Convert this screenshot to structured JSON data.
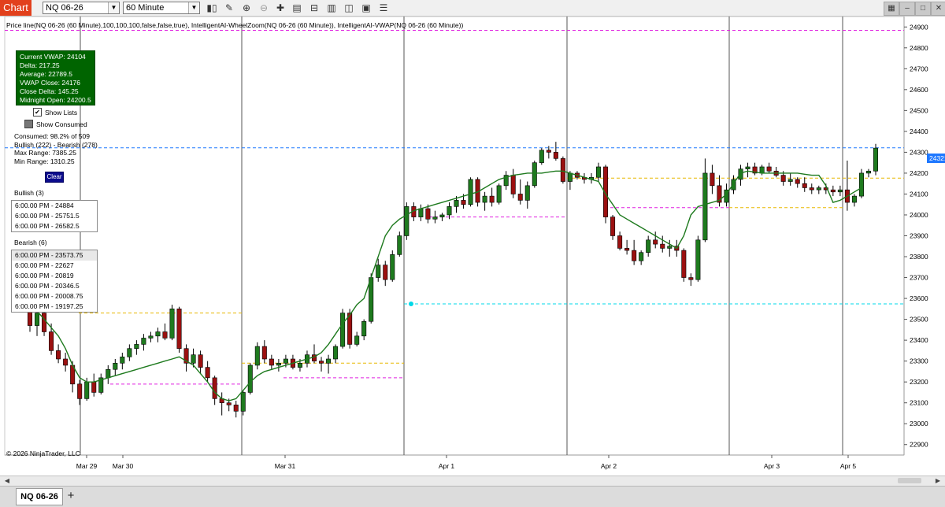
{
  "toolbar": {
    "chart_tab": "Chart",
    "instrument": "NQ 06-26",
    "interval": "60 Minute",
    "tools": [
      "bars-icon",
      "pencil-icon",
      "zoom-in-icon",
      "zoom-out-icon",
      "crosshair-icon",
      "properties-icon",
      "strategies-icon",
      "indicators-icon",
      "data-box-icon",
      "chart-trader-icon",
      "templates-icon",
      "share-icon"
    ],
    "window_buttons": [
      "restore-icon",
      "minimize-icon",
      "maximize-icon",
      "close-icon"
    ]
  },
  "indicator_line": "Price line(NQ 06-26 (60 Minute),100,100,100,false,false,true), IntelligentAI-WheelZoom(NQ 06-26 (60 Minute)), IntelligentAI-VWAP(NQ 06-26 (60 Minute))",
  "vwap_box": {
    "current_vwap": "Current VWAP: 24104",
    "delta": "Delta: 217.25",
    "average": "Average: 22789.5",
    "vwap_close": "VWAP Close: 24176",
    "close_delta": "Close Delta: 145.25",
    "midnight_open": "Midnight Open: 24200.5"
  },
  "options": {
    "show_lists": "Show Lists",
    "show_lists_checked": true,
    "show_consumed": "Show Consumed",
    "show_consumed_checked": false
  },
  "stats": {
    "consumed": "Consumed: 98.2% of 509",
    "bull_bear": "Bullish (222) - Bearish (278)",
    "max_range": "Max Range: 7385.25",
    "min_range": "Min Range: 1310.25"
  },
  "clear_button": "Clear",
  "bullish": {
    "title": "Bullish (3)",
    "rows": [
      "6:00.00 PM - 24884",
      "6:00.00 PM - 25751.5",
      "6:00.00 PM - 26582.5"
    ]
  },
  "bearish": {
    "title": "Bearish (6)",
    "rows": [
      "6:00.00 PM - 23573.75",
      "6:00.00 PM - 22627",
      "6:00.00 PM - 20819",
      "6:00.00 PM - 20346.5",
      "6:00.00 PM - 20008.75",
      "6:00.00 PM - 19197.25"
    ]
  },
  "copyright": "© 2026 NinjaTrader, LLC",
  "last_price": "24321.25",
  "bottom": {
    "tab": "NQ 06-26",
    "add": "+"
  },
  "colors": {
    "bull": "#1e7a1e",
    "bear": "#9b1010",
    "vwap": "#1e7a1e",
    "vwap_bear": "#9b1010",
    "magenta": "#e020e0",
    "gold": "#e8b800",
    "cyan": "#00d8e8",
    "price_line": "#1e78ff"
  },
  "chart_data": {
    "type": "candlestick",
    "y_ticks": [
      22900,
      23000,
      23100,
      23200,
      23300,
      23400,
      23500,
      23600,
      23700,
      23800,
      23900,
      24000,
      24100,
      24200,
      24300,
      24400,
      24500,
      24600,
      24700,
      24800,
      24900
    ],
    "ylim": [
      22850,
      24950
    ],
    "x_labels": [
      "Mar 29",
      "Mar 30",
      "Mar 31",
      "Apr 1",
      "Apr 2",
      "Apr 3",
      "Apr 5"
    ],
    "session_breaks": [
      "Mar 29",
      "Mar 31",
      "Apr 1",
      "Apr 2",
      "Apr 3",
      "Apr 5"
    ],
    "ohlc": [
      [
        23560,
        23575,
        23440,
        23470
      ],
      [
        23470,
        23560,
        23420,
        23530
      ],
      [
        23530,
        23560,
        23420,
        23440
      ],
      [
        23440,
        23480,
        23330,
        23350
      ],
      [
        23350,
        23380,
        23290,
        23310
      ],
      [
        23310,
        23340,
        23250,
        23280
      ],
      [
        23280,
        23300,
        23150,
        23190
      ],
      [
        23190,
        23210,
        23090,
        23120
      ],
      [
        23120,
        23220,
        23110,
        23200
      ],
      [
        23200,
        23240,
        23130,
        23150
      ],
      [
        23150,
        23240,
        23140,
        23220
      ],
      [
        23220,
        23280,
        23190,
        23260
      ],
      [
        23260,
        23310,
        23230,
        23290
      ],
      [
        23290,
        23340,
        23260,
        23320
      ],
      [
        23320,
        23380,
        23300,
        23360
      ],
      [
        23360,
        23400,
        23330,
        23380
      ],
      [
        23380,
        23430,
        23350,
        23410
      ],
      [
        23410,
        23440,
        23390,
        23420
      ],
      [
        23420,
        23460,
        23390,
        23440
      ],
      [
        23440,
        23480,
        23400,
        23410
      ],
      [
        23410,
        23570,
        23400,
        23550
      ],
      [
        23550,
        23560,
        23340,
        23360
      ],
      [
        23360,
        23380,
        23250,
        23290
      ],
      [
        23290,
        23360,
        23270,
        23330
      ],
      [
        23330,
        23350,
        23240,
        23270
      ],
      [
        23270,
        23300,
        23200,
        23220
      ],
      [
        23220,
        23230,
        23090,
        23120
      ],
      [
        23120,
        23150,
        23040,
        23100
      ],
      [
        23100,
        23120,
        23060,
        23090
      ],
      [
        23090,
        23110,
        23030,
        23060
      ],
      [
        23060,
        23160,
        23040,
        23150
      ],
      [
        23150,
        23290,
        23140,
        23280
      ],
      [
        23280,
        23390,
        23260,
        23370
      ],
      [
        23370,
        23400,
        23290,
        23310
      ],
      [
        23310,
        23330,
        23260,
        23280
      ],
      [
        23280,
        23310,
        23250,
        23290
      ],
      [
        23290,
        23330,
        23270,
        23310
      ],
      [
        23310,
        23330,
        23260,
        23270
      ],
      [
        23270,
        23310,
        23250,
        23290
      ],
      [
        23290,
        23350,
        23270,
        23330
      ],
      [
        23330,
        23380,
        23290,
        23300
      ],
      [
        23300,
        23320,
        23250,
        23290
      ],
      [
        23290,
        23330,
        23240,
        23310
      ],
      [
        23310,
        23380,
        23290,
        23370
      ],
      [
        23370,
        23550,
        23360,
        23530
      ],
      [
        23530,
        23550,
        23360,
        23380
      ],
      [
        23380,
        23440,
        23370,
        23420
      ],
      [
        23420,
        23500,
        23400,
        23490
      ],
      [
        23490,
        23720,
        23480,
        23700
      ],
      [
        23700,
        23790,
        23680,
        23760
      ],
      [
        23760,
        23780,
        23660,
        23690
      ],
      [
        23690,
        23830,
        23680,
        23810
      ],
      [
        23810,
        23920,
        23800,
        23900
      ],
      [
        23900,
        24060,
        23880,
        24040
      ],
      [
        24040,
        24060,
        23970,
        23990
      ],
      [
        23990,
        24050,
        23970,
        24030
      ],
      [
        24030,
        24050,
        23960,
        23980
      ],
      [
        23980,
        24020,
        23960,
        23990
      ],
      [
        23990,
        24010,
        23970,
        24000
      ],
      [
        24000,
        24060,
        23980,
        24040
      ],
      [
        24040,
        24090,
        24010,
        24070
      ],
      [
        24070,
        24100,
        24030,
        24050
      ],
      [
        24050,
        24180,
        24040,
        24170
      ],
      [
        24170,
        24180,
        24040,
        24060
      ],
      [
        24060,
        24110,
        24020,
        24090
      ],
      [
        24090,
        24130,
        24040,
        24060
      ],
      [
        24060,
        24150,
        24050,
        24140
      ],
      [
        24140,
        24210,
        24120,
        24190
      ],
      [
        24190,
        24220,
        24080,
        24100
      ],
      [
        24100,
        24170,
        24050,
        24070
      ],
      [
        24070,
        24160,
        24030,
        24140
      ],
      [
        24140,
        24260,
        24130,
        24250
      ],
      [
        24250,
        24320,
        24240,
        24310
      ],
      [
        24310,
        24330,
        24270,
        24300
      ],
      [
        24300,
        24350,
        24260,
        24270
      ],
      [
        24270,
        24280,
        24150,
        24160
      ],
      [
        24160,
        24210,
        24120,
        24200
      ],
      [
        24200,
        24210,
        24170,
        24180
      ],
      [
        24180,
        24200,
        24150,
        24170
      ],
      [
        24170,
        24200,
        24150,
        24180
      ],
      [
        24180,
        24250,
        24160,
        24230
      ],
      [
        24230,
        24240,
        23960,
        23990
      ],
      [
        23990,
        24000,
        23880,
        23900
      ],
      [
        23900,
        23920,
        23830,
        23840
      ],
      [
        23840,
        23880,
        23810,
        23830
      ],
      [
        23830,
        23880,
        23760,
        23780
      ],
      [
        23780,
        23830,
        23760,
        23820
      ],
      [
        23820,
        23900,
        23800,
        23880
      ],
      [
        23880,
        23920,
        23840,
        23860
      ],
      [
        23860,
        23900,
        23820,
        23840
      ],
      [
        23840,
        23880,
        23800,
        23850
      ],
      [
        23850,
        23880,
        23800,
        23830
      ],
      [
        23830,
        23840,
        23680,
        23700
      ],
      [
        23700,
        23720,
        23660,
        23690
      ],
      [
        23690,
        23900,
        23680,
        23880
      ],
      [
        23880,
        24270,
        23870,
        24200
      ],
      [
        24200,
        24240,
        24100,
        24140
      ],
      [
        24140,
        24190,
        24040,
        24060
      ],
      [
        24060,
        24150,
        24040,
        24120
      ],
      [
        24120,
        24190,
        24100,
        24170
      ],
      [
        24170,
        24240,
        24140,
        24220
      ],
      [
        24220,
        24250,
        24180,
        24230
      ],
      [
        24230,
        24250,
        24190,
        24200
      ],
      [
        24200,
        24240,
        24190,
        24230
      ],
      [
        24230,
        24250,
        24200,
        24210
      ],
      [
        24210,
        24230,
        24180,
        24190
      ],
      [
        24190,
        24210,
        24140,
        24160
      ],
      [
        24160,
        24200,
        24140,
        24170
      ],
      [
        24170,
        24180,
        24130,
        24150
      ],
      [
        24150,
        24180,
        24110,
        24130
      ],
      [
        24130,
        24150,
        24100,
        24120
      ],
      [
        24120,
        24140,
        24100,
        24130
      ],
      [
        24130,
        24150,
        24100,
        24120
      ],
      [
        24120,
        24140,
        24090,
        24110
      ],
      [
        24110,
        24140,
        24090,
        24120
      ],
      [
        24120,
        24260,
        24020,
        24060
      ],
      [
        24060,
        24100,
        24040,
        24090
      ],
      [
        24090,
        24220,
        24080,
        24200
      ],
      [
        24200,
        24220,
        24180,
        24210
      ],
      [
        24210,
        24340,
        24190,
        24320
      ]
    ],
    "vwap": [
      23580,
      23540,
      23500,
      23460,
      23420,
      23360,
      23280,
      23220,
      23200,
      23200,
      23210,
      23220,
      23230,
      23240,
      23250,
      23260,
      23270,
      23280,
      23290,
      23300,
      23310,
      23320,
      23300,
      23280,
      23240,
      23200,
      23150,
      23120,
      23110,
      23120,
      23160,
      23200,
      23230,
      23250,
      23260,
      23270,
      23280,
      23290,
      23300,
      23310,
      23320,
      23340,
      23380,
      23430,
      23480,
      23520,
      23570,
      23600,
      23700,
      23800,
      23900,
      23950,
      23980,
      24000,
      24020,
      24030,
      24040,
      24050,
      24060,
      24070,
      24080,
      24090,
      24100,
      24110,
      24130,
      24150,
      24170,
      24180,
      24190,
      24195,
      24200,
      24200,
      24200,
      24205,
      24210,
      24210,
      24200,
      24190,
      24180,
      24170,
      24160,
      24100,
      24050,
      24000,
      23980,
      23960,
      23940,
      23920,
      23900,
      23880,
      23860,
      23840,
      23900,
      24000,
      24040,
      24050,
      24060,
      24070,
      24100,
      24150,
      24200,
      24210,
      24205,
      24200,
      24200,
      24200,
      24200,
      24200,
      24200,
      24195,
      24190,
      24190,
      24140,
      24060,
      24070,
      24090,
      24110,
      24130
    ],
    "levels": [
      {
        "kind": "magenta",
        "price": 24884
      },
      {
        "kind": "price_line",
        "price": 24321.25
      },
      {
        "kind": "gold",
        "price": 23530
      },
      {
        "kind": "magenta",
        "price": 23190
      },
      {
        "kind": "gold",
        "price": 23290
      },
      {
        "kind": "magenta",
        "price": 23220
      },
      {
        "kind": "cyan",
        "price": 23573.75
      },
      {
        "kind": "magenta",
        "price": 23990
      },
      {
        "kind": "gold",
        "price": 24176
      },
      {
        "kind": "magenta",
        "price": 24035
      },
      {
        "kind": "gold",
        "price": 24035
      }
    ]
  }
}
